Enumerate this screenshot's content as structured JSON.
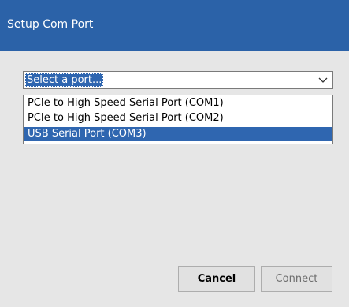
{
  "window": {
    "title": "Setup Com Port"
  },
  "port_select": {
    "placeholder": "Select a port...",
    "options": [
      "PCIe to High Speed Serial Port (COM1)",
      "PCIe to High Speed Serial Port (COM2)",
      "USB Serial Port (COM3)"
    ],
    "highlighted_option": "USB Serial Port (COM3)",
    "arrow_icon": "chevron-down-icon"
  },
  "buttons": {
    "cancel_label": "Cancel",
    "connect_label": "Connect"
  },
  "colors": {
    "titlebar": "#2b62a8",
    "selection": "#2f66b0",
    "dialog_bg": "#e6e6e6"
  }
}
